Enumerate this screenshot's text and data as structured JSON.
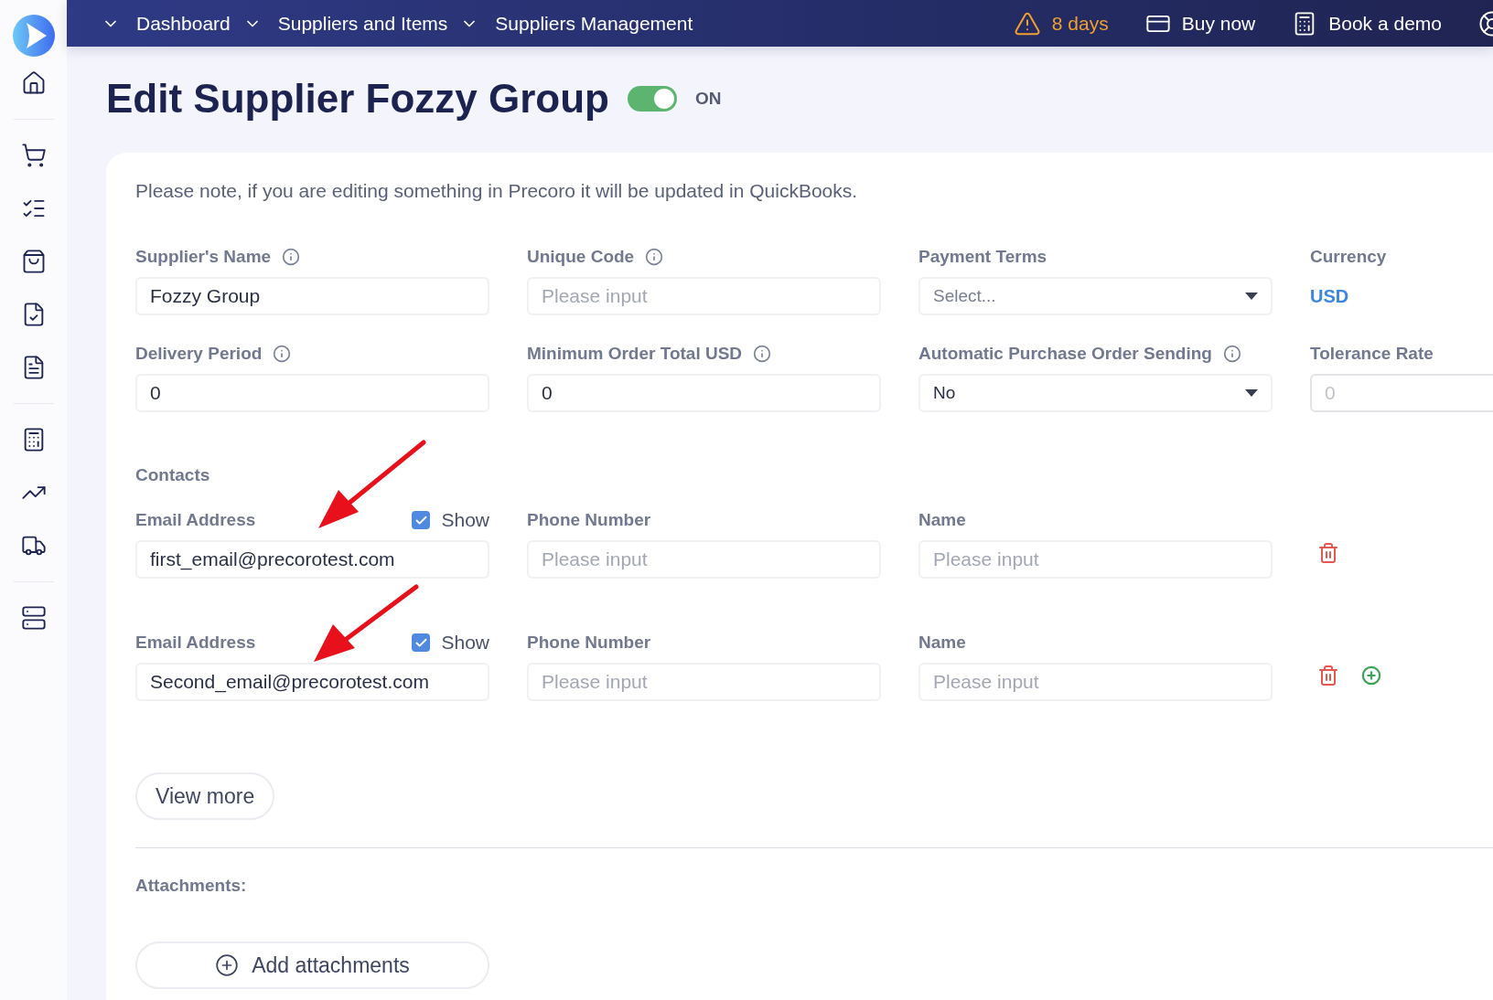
{
  "breadcrumbs": [
    {
      "label": "Dashboard"
    },
    {
      "label": "Suppliers and Items"
    },
    {
      "label": "Suppliers Management"
    }
  ],
  "topbar": {
    "trial": "8 days",
    "buy": "Buy now",
    "demo": "Book a demo"
  },
  "title": "Edit Supplier Fozzy Group",
  "toggle": {
    "on": true,
    "label": "ON"
  },
  "note": "Please note, if you are editing something in Precoro it will be updated in QuickBooks.",
  "fields": [
    {
      "label": "Supplier's Name",
      "info": true,
      "kind": "input",
      "value": "Fozzy Group",
      "disabled": false
    },
    {
      "label": "Unique Code",
      "info": true,
      "kind": "input",
      "placeholder": "Please input",
      "disabled": false
    },
    {
      "label": "Payment Terms",
      "info": false,
      "kind": "select",
      "placeholder": "Select...",
      "disabled": false
    },
    {
      "label": "Currency",
      "info": false,
      "kind": "link",
      "value": "USD",
      "disabled": false
    },
    {
      "label": "Delivery Period",
      "info": true,
      "kind": "input",
      "value": "0",
      "disabled": false
    },
    {
      "label": "Minimum Order Total USD",
      "info": true,
      "kind": "input",
      "value": "0",
      "disabled": false
    },
    {
      "label": "Automatic Purchase Order Sending",
      "info": true,
      "kind": "select",
      "value": "No",
      "disabled": false
    },
    {
      "label": "Tolerance Rate",
      "info": false,
      "kind": "input",
      "placeholder": "0",
      "disabled": true
    }
  ],
  "contacts": {
    "title": "Contacts",
    "rows": [
      {
        "email_label": "Email Address",
        "show_label": "Show",
        "show": true,
        "email": "first_email@precorotest.com",
        "phone_label": "Phone Number",
        "phone_placeholder": "Please input",
        "name_label": "Name",
        "name_placeholder": "Please input",
        "add": false
      },
      {
        "email_label": "Email Address",
        "show_label": "Show",
        "show": true,
        "email": "Second_email@precorotest.com",
        "phone_label": "Phone Number",
        "phone_placeholder": "Please input",
        "name_label": "Name",
        "name_placeholder": "Please input",
        "add": true
      }
    ]
  },
  "view_more": "View more",
  "attachments": {
    "title": "Attachments:",
    "button": "Add attachments"
  }
}
